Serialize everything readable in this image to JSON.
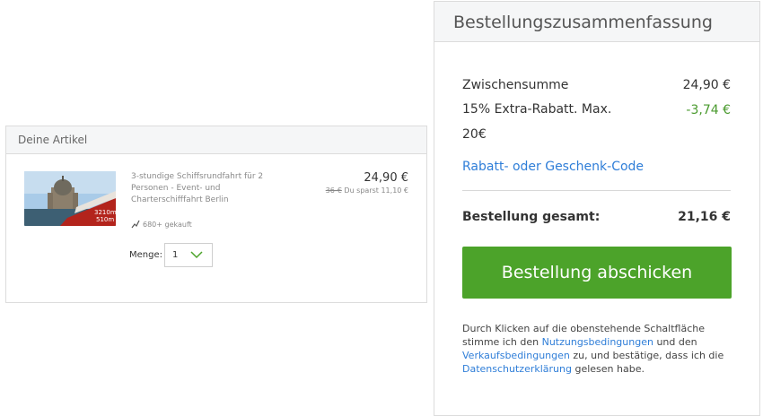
{
  "articles": {
    "header": "Deine Artikel",
    "item": {
      "title": "3-stundige Schiffsrundfahrt für 2 Personen - Event- und Charterschifffahrt Berlin",
      "price": "24,90 €",
      "old_price": "36-€",
      "savings": "Du sparst 11,10 €",
      "sold": "680+ gekauft",
      "quantity_label": "Menge:",
      "quantity_value": "1"
    }
  },
  "summary": {
    "header": "Bestellungszusammenfassung",
    "subtotal_label": "Zwischensumme",
    "subtotal_value": "24,90 €",
    "discount_label": "15% Extra-Rabatt. Max. 20€",
    "discount_value": "-3,74 €",
    "coupon_link": "Rabatt- oder Geschenk-Code",
    "total_label": "Bestellung gesamt:",
    "total_value": "21,16 €",
    "submit_label": "Bestellung abschicken",
    "legal": {
      "part1": "Durch Klicken auf die obenstehende Schaltfläche stimme ich den ",
      "link_terms": "Nutzungsbedingungen",
      "part2": " und den ",
      "link_sales": "Verkaufsbedingungen",
      "part3": " zu, und bestätige, dass ich die ",
      "link_privacy": "Datenschutzerklärung",
      "part4": " gelesen habe."
    }
  },
  "colors": {
    "accent_green": "#4ca32a",
    "discount_green": "#4a9a2e",
    "link_blue": "#2f7ed8",
    "header_bg": "#f5f6f7"
  },
  "icons": {
    "sold": "trending-up-icon",
    "quantity_dropdown": "chevron-down-icon"
  }
}
